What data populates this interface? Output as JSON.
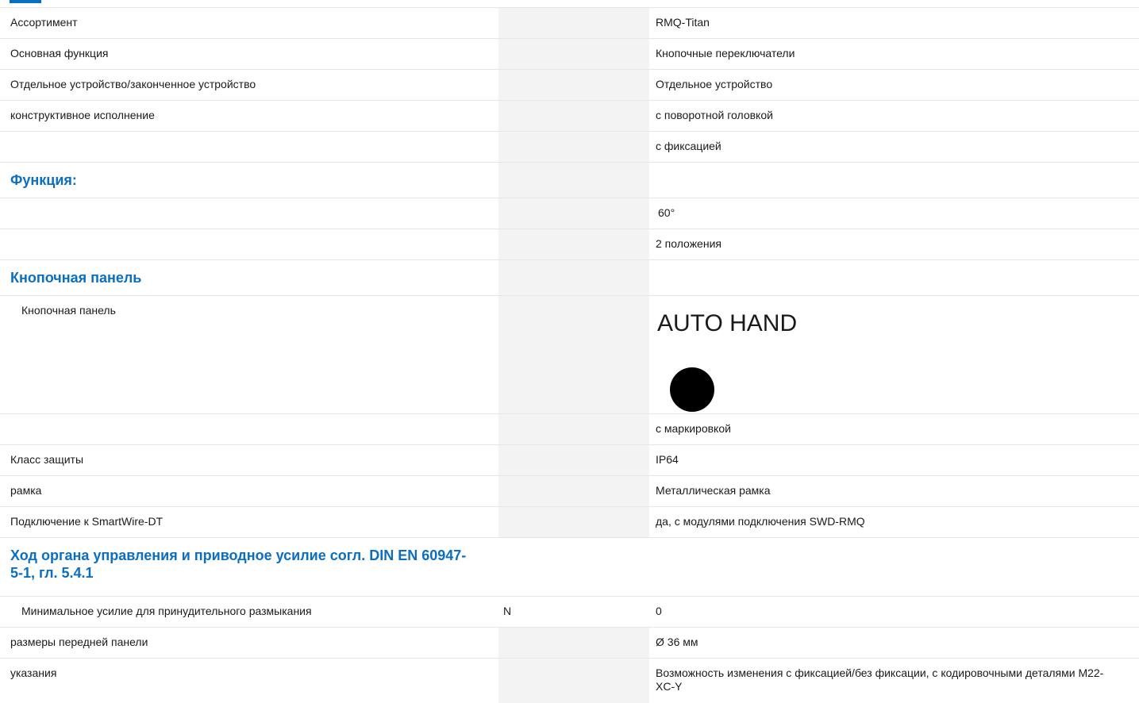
{
  "rows": [
    {
      "label": "Ассортимент",
      "unit": "",
      "value": "RMQ-Titan"
    },
    {
      "label": "Основная функция",
      "unit": "",
      "value": "Кнопочные переключатели"
    },
    {
      "label": "Отдельное устройство/законченное устройство",
      "unit": "",
      "value": "Отдельное устройство"
    },
    {
      "label": "конструктивное исполнение",
      "unit": "",
      "value": "с поворотной головкой"
    },
    {
      "label": "",
      "unit": "",
      "value": "с фиксацией"
    }
  ],
  "section_function": {
    "title": "Функция:"
  },
  "function_rows": [
    {
      "label": "",
      "value": "60°"
    },
    {
      "label": "",
      "value": "2 положения"
    }
  ],
  "section_panel": {
    "title": "Кнопочная панель"
  },
  "panel": {
    "label": "Кнопочная панель",
    "legend_text": "AUTO HAND",
    "marking": "с маркировкой"
  },
  "rows2": [
    {
      "label": "Класс защиты",
      "value": "IP64"
    },
    {
      "label": "рамка",
      "value": "Металлическая рамка"
    },
    {
      "label": "Подключение к SmartWire-DT",
      "value": "да, с модулями подключения SWD-RMQ"
    }
  ],
  "section_force": {
    "title": "Ход органа управления и приводное усилие согл. DIN EN 60947-5-1, гл. 5.4.1"
  },
  "force_row": {
    "label": "Минимальное усилие для принудительного размыкания",
    "unit": "N",
    "value": "0"
  },
  "rows3": [
    {
      "label": "размеры передней панели",
      "value": "Ø 36 мм"
    },
    {
      "label": "указания",
      "value": "Возможность изменения с фиксацией/без фиксации, с кодировочными деталями M22-XC-Y"
    }
  ]
}
